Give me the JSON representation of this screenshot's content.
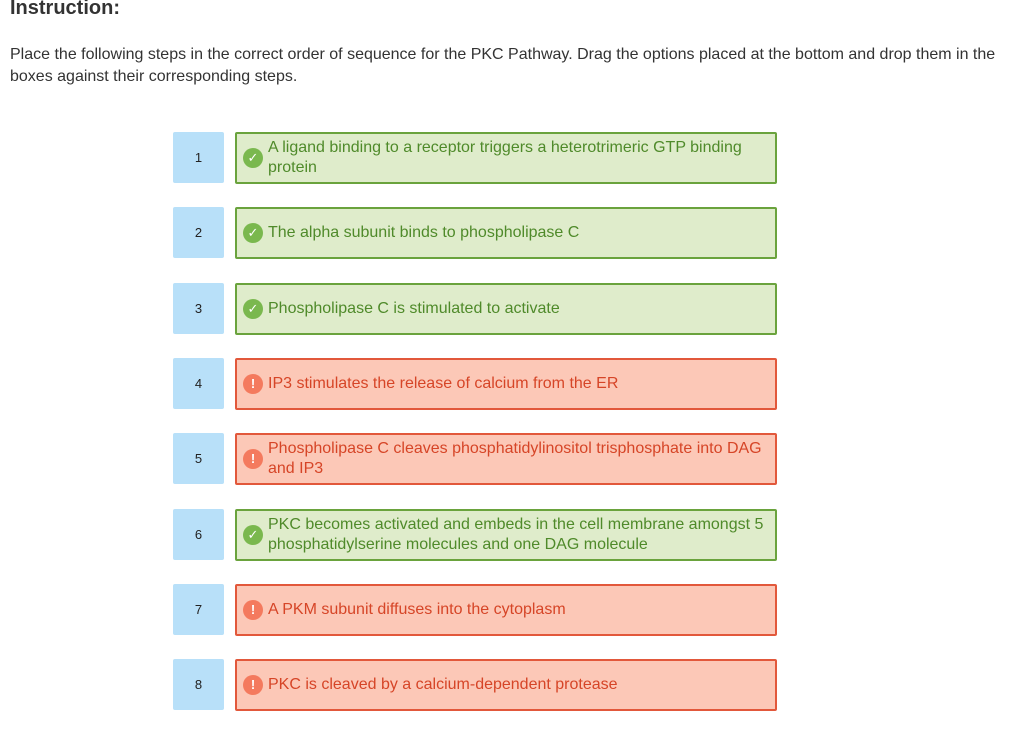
{
  "header": {
    "title": "Instruction:"
  },
  "instruction": "Place the following steps in the correct order of sequence for the PKC Pathway. Drag the options placed at the bottom and drop them in the boxes against their corresponding steps.",
  "colors": {
    "correct_bg": "#dfeccb",
    "correct_border": "#6aa33d",
    "wrong_bg": "#fcc8b7",
    "wrong_border": "#e2583b",
    "step_bg": "#b8e0f9"
  },
  "steps": [
    {
      "number": "1",
      "text": "A ligand binding to a receptor triggers a heterotrimeric GTP binding protein",
      "status": "correct",
      "icon": "check-icon"
    },
    {
      "number": "2",
      "text": "The alpha subunit binds to phospholipase C",
      "status": "correct",
      "icon": "check-icon"
    },
    {
      "number": "3",
      "text": "Phospholipase C is stimulated to activate",
      "status": "correct",
      "icon": "check-icon"
    },
    {
      "number": "4",
      "text": "IP3 stimulates the release of calcium from the ER",
      "status": "wrong",
      "icon": "exclamation-icon"
    },
    {
      "number": "5",
      "text": "Phospholipase C cleaves phosphatidylinositol trisphosphate into DAG and IP3",
      "status": "wrong",
      "icon": "exclamation-icon"
    },
    {
      "number": "6",
      "text": "PKC becomes activated and embeds in the cell membrane amongst 5 phosphatidylserine molecules and one DAG molecule",
      "status": "correct",
      "icon": "check-icon"
    },
    {
      "number": "7",
      "text": "A PKM subunit diffuses into the cytoplasm",
      "status": "wrong",
      "icon": "exclamation-icon"
    },
    {
      "number": "8",
      "text": "PKC is cleaved by a calcium-dependent protease",
      "status": "wrong",
      "icon": "exclamation-icon"
    }
  ]
}
